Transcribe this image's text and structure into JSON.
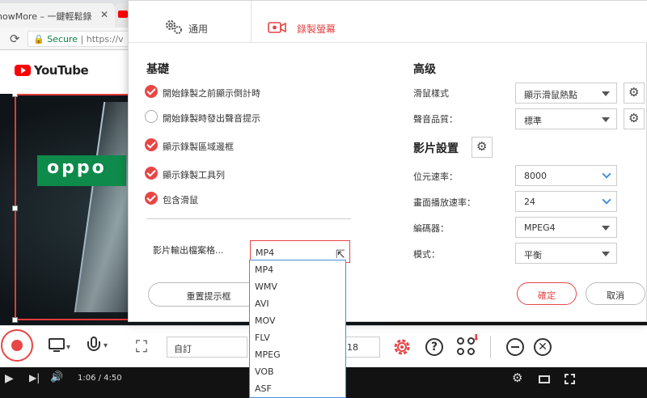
{
  "browser": {
    "tab1_title": "howMore – 一鍵輕鬆錄",
    "tab1_close": "✕",
    "secure_label": "Secure",
    "url_text": "https://v",
    "site_name": "YouTube",
    "video_time": "1:06 / 4:50",
    "video_logo_text": "oppo"
  },
  "dialog": {
    "tabs": [
      {
        "label": "通用",
        "active": false
      },
      {
        "label": "錄製螢幕",
        "active": true
      }
    ],
    "basic": {
      "title": "基礎",
      "options": [
        {
          "label": "開始錄製之前顯示倒計時",
          "checked": true
        },
        {
          "label": "開始錄製時發出聲音提示",
          "checked": false
        },
        {
          "label": "顯示錄製區域邊框",
          "checked": true
        },
        {
          "label": "顯示錄製工具列",
          "checked": true
        },
        {
          "label": "包含滑鼠",
          "checked": true
        }
      ],
      "format_label": "影片輸出檔案格...",
      "format_value": "MP4",
      "reset_label": "重置提示框"
    },
    "advanced": {
      "title": "高级",
      "cursor_style_label": "滑鼠樣式",
      "cursor_style_value": "顯示滑鼠熱點",
      "audio_quality_label": "聲音品質：",
      "audio_quality_value": "標準"
    },
    "video": {
      "title": "影片設置",
      "bitrate_label": "位元速率：",
      "bitrate_value": "8000",
      "framerate_label": "畫面播放速率：",
      "framerate_value": "24",
      "encoder_label": "編碼器：",
      "encoder_value": "MPEG4",
      "mode_label": "模式：",
      "mode_value": "平衡"
    },
    "ok_label": "確定",
    "cancel_label": "取消"
  },
  "format_dropdown": [
    "MP4",
    "WMV",
    "AVI",
    "MOV",
    "FLV",
    "MPEG",
    "VOB",
    "ASF"
  ],
  "toolbar": {
    "region_label": "自訂",
    "size_value": "18"
  },
  "colors": {
    "accent": "#e84545",
    "focus": "#4a90d9"
  }
}
